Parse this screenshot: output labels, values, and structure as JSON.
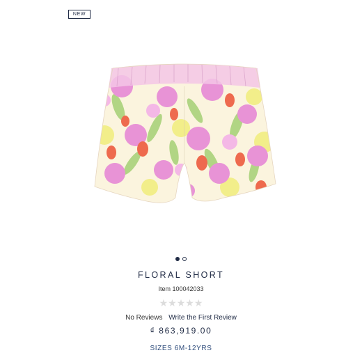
{
  "badge": {
    "label": "NEW"
  },
  "product": {
    "title": "FLORAL SHORT",
    "item_number": "Item 100042033",
    "stars": "★★★★★",
    "rating_value": 0,
    "no_reviews": "No Reviews",
    "write_review": "Write the First Review",
    "price": "₫ 863,919.00",
    "sizes": "SIZES 6M-12YRS"
  },
  "carousel": {
    "total": 2,
    "active_index": 0
  },
  "icons": [
    "star-icon",
    "carousel-dot"
  ],
  "colors": {
    "text_navy": "#1f2a44",
    "sizes_blue": "#2c4a7a",
    "star_empty": "#dcdcdc",
    "print_pink": "#e58fd0",
    "print_coral": "#ee6a4e",
    "print_yellow": "#f3f08a",
    "print_green": "#9ccb6a"
  }
}
